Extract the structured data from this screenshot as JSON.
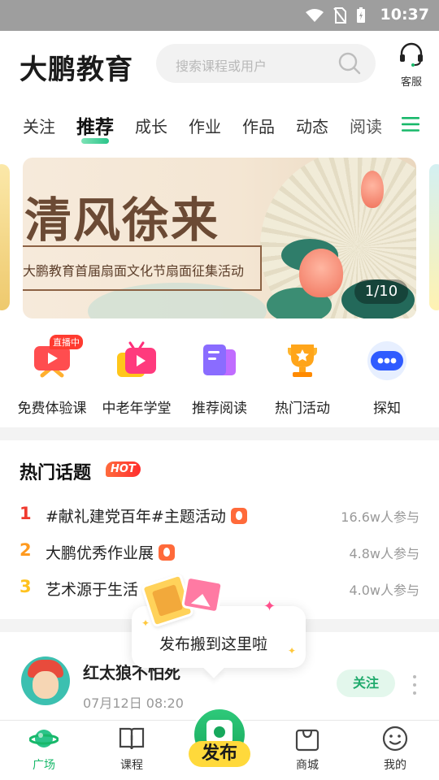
{
  "status_bar": {
    "time": "10:37"
  },
  "header": {
    "brand": "大鹏教育",
    "search_placeholder": "搜索课程或用户",
    "service_label": "客服"
  },
  "tabs": [
    {
      "label": "关注",
      "active": false
    },
    {
      "label": "推荐",
      "active": true
    },
    {
      "label": "成长",
      "active": false
    },
    {
      "label": "作业",
      "active": false
    },
    {
      "label": "作品",
      "active": false
    },
    {
      "label": "动态",
      "active": false
    },
    {
      "label": "阅读",
      "active": false
    }
  ],
  "banner": {
    "title": "清风徐来",
    "subtitle": "大鹏教育首届扇面文化节扇面征集活动",
    "counter": "1/10"
  },
  "quick_links": [
    {
      "label": "免费体验课",
      "icon": "tv-play-icon",
      "badge": "直播中"
    },
    {
      "label": "中老年学堂",
      "icon": "tv-play-icon"
    },
    {
      "label": "推荐阅读",
      "icon": "book-icon"
    },
    {
      "label": "热门活动",
      "icon": "trophy-icon"
    },
    {
      "label": "探知",
      "icon": "dots-bubble-icon"
    }
  ],
  "hot_topics": {
    "title": "热门话题",
    "badge": "HOT",
    "items": [
      {
        "rank": "1",
        "text": "#献礼建党百年#主题活动",
        "count": "16.6w人参与",
        "rank_color": "#f03a2e"
      },
      {
        "rank": "2",
        "text": "大鹏优秀作业展",
        "count": "4.8w人参与",
        "rank_color": "#ff9a1f"
      },
      {
        "rank": "3",
        "text": "艺术源于生活",
        "count": "4.0w人参与",
        "rank_color": "#ffc21f"
      }
    ]
  },
  "tooltip": {
    "text": "发布搬到这里啦"
  },
  "post": {
    "user_name": "红太狼不怕死",
    "date": "07月12日  08:20",
    "follow_label": "关注"
  },
  "tab_bar": {
    "items": [
      {
        "label": "广场",
        "active": true
      },
      {
        "label": "课程",
        "active": false
      },
      {
        "label": "商城",
        "active": false
      },
      {
        "label": "我的",
        "active": false
      }
    ],
    "publish_label": "发布"
  },
  "colors": {
    "accent": "#18b86a",
    "status_bar": "#9e9e9e",
    "hot_badge": "#ff3b30",
    "follow_bg": "#e3f7ec"
  }
}
